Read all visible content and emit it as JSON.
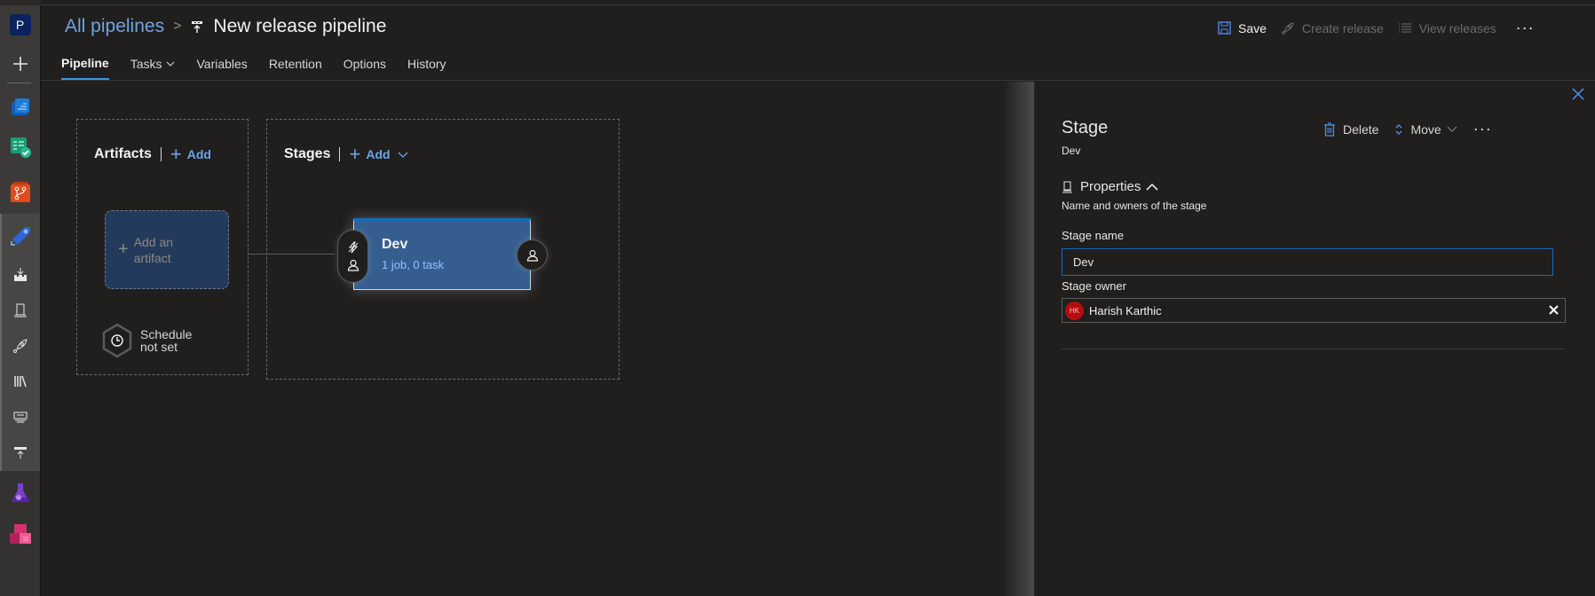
{
  "rail": {
    "org_initial": "P",
    "items": [
      {
        "name": "overview",
        "color": "#1f7bd6"
      },
      {
        "name": "boards",
        "color": "#1aa37a"
      },
      {
        "name": "repos",
        "color": "#d94a1e"
      },
      {
        "name": "pipelines",
        "color": "#2e66d6"
      },
      {
        "name": "builds"
      },
      {
        "name": "environments"
      },
      {
        "name": "releases"
      },
      {
        "name": "library"
      },
      {
        "name": "task-groups"
      },
      {
        "name": "deployment-groups"
      },
      {
        "name": "test-plans",
        "color": "#7b3fc8"
      },
      {
        "name": "artifacts",
        "color": "#d6306e"
      }
    ]
  },
  "header": {
    "breadcrumb_root": "All pipelines",
    "title": "New release pipeline",
    "tabs": [
      {
        "label": "Pipeline",
        "active": true
      },
      {
        "label": "Tasks",
        "active": false,
        "dropdown": true
      },
      {
        "label": "Variables",
        "active": false
      },
      {
        "label": "Retention",
        "active": false
      },
      {
        "label": "Options",
        "active": false
      },
      {
        "label": "History",
        "active": false
      }
    ],
    "actions": {
      "save": "Save",
      "create_release": "Create release",
      "view_releases": "View releases",
      "more": "···"
    }
  },
  "canvas": {
    "artifacts": {
      "title": "Artifacts",
      "add": "Add",
      "placeholder_line1": "Add an",
      "placeholder_line2": "artifact",
      "schedule_line1": "Schedule",
      "schedule_line2": "not set"
    },
    "stages": {
      "title": "Stages",
      "add": "Add",
      "stage": {
        "name": "Dev",
        "summary": "1 job, 0 task"
      }
    }
  },
  "panel": {
    "title": "Stage",
    "subtitle": "Dev",
    "delete": "Delete",
    "move": "Move",
    "more": "···",
    "section_title": "Properties",
    "section_desc": "Name and owners of the stage",
    "stage_name_label": "Stage name",
    "stage_name_value": "Dev",
    "stage_owner_label": "Stage owner",
    "owner": {
      "initials": "HK",
      "name": "Harish Karthic"
    }
  },
  "colors": {
    "accent": "#3a96dd",
    "link": "#6ea4e6",
    "stage_card": "#355e8f",
    "avatar": "#b50d0d"
  }
}
